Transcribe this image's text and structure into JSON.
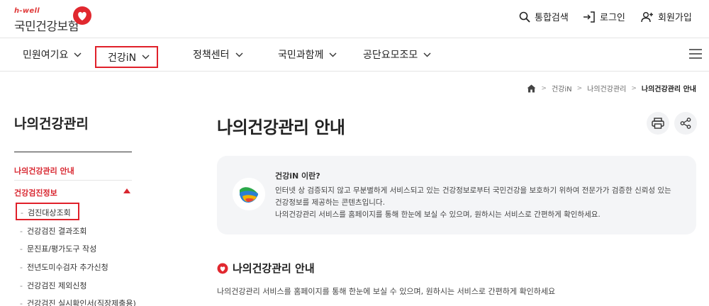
{
  "header": {
    "logo_sub": "h-well",
    "logo_main": "국민건강보험",
    "util": {
      "search_label": "통합검색",
      "login_label": "로그인",
      "signup_label": "회원가입"
    }
  },
  "gnb": {
    "items": [
      {
        "label": "민원여기요"
      },
      {
        "label": "건강iN"
      },
      {
        "label": "정책센터"
      },
      {
        "label": "국민과함께"
      },
      {
        "label": "공단요모조모"
      }
    ],
    "menu_icon": "hamburger-icon"
  },
  "breadcrumb": {
    "items": [
      "건강iN",
      "나의건강관리"
    ],
    "current": "나의건강관리 안내"
  },
  "sidebar": {
    "title": "나의건강관리",
    "menu1": "나의건강관리 안내",
    "menu2": "건강검진정보",
    "sub_items": [
      {
        "label": "검진대상조회"
      },
      {
        "label": "건강검진 결과조회"
      },
      {
        "label": "문진표/평가도구 작성"
      },
      {
        "label": "전년도미수검자 추가신청"
      },
      {
        "label": "건강검진 제외신청"
      },
      {
        "label": "건강검진 실시확인서(직장제출용)"
      }
    ]
  },
  "main": {
    "title": "나의건강관리 안내",
    "print_icon": "print-icon",
    "share_icon": "share-icon",
    "info": {
      "heading": "건강iN 이란?",
      "lines": [
        "인터넷 상 검증되지 않고 무분별하게 서비스되고 있는 건강정보로부터 국민건강을 보호하기 위하여 전문가가 검증한 신뢰성 있는",
        "건강정보를 제공하는 콘텐츠입니다.",
        "나의건강관리 서비스를 홈페이지를 통해 한눈에 보실 수 있으며, 원하시는 서비스로 간편하게 확인하세요."
      ]
    },
    "section": {
      "title": "나의건강관리 안내",
      "desc": "나의건강관리 서비스를 홈페이지를 통해 한눈에 보실 수 있으며, 원하시는 서비스로 간편하게 확인하세요"
    }
  },
  "colors": {
    "accent_red": "#d8262f",
    "highlight_border": "#e0202a",
    "info_bg": "#f4f5f7"
  }
}
